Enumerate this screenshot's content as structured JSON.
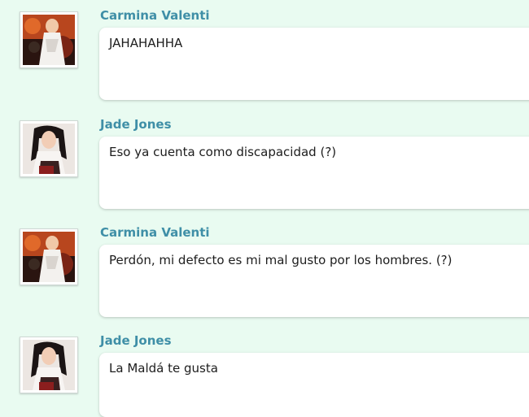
{
  "messages": [
    {
      "author": "Carmina Valenti",
      "text": "JAHAHAHHA",
      "avatar": "carmina-avatar"
    },
    {
      "author": "Jade Jones",
      "text": "Eso ya cuenta como discapacidad (?)",
      "avatar": "jade-avatar"
    },
    {
      "author": "Carmina Valenti",
      "text": "Perdón, mi defecto es mi mal gusto por los hombres. (?)",
      "avatar": "carmina-avatar"
    },
    {
      "author": "Jade Jones",
      "text": "La Maldá te gusta",
      "avatar": "jade-avatar"
    }
  ],
  "colors": {
    "background": "#e9fbf1",
    "author_name": "#3f8fa7",
    "bubble": "#ffffff"
  }
}
